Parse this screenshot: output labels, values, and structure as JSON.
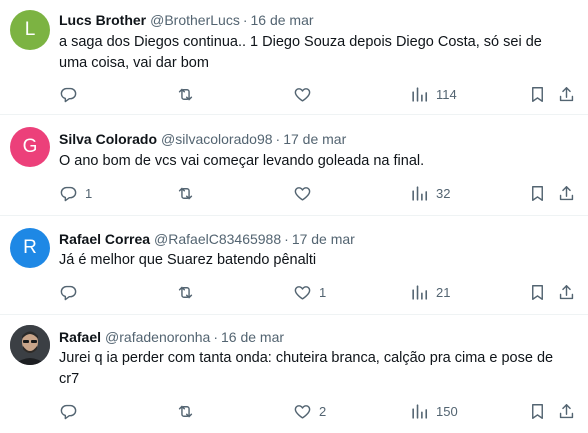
{
  "tweets": [
    {
      "avatar_letter": "L",
      "avatar_color": "#7cb342",
      "name": "Lucs Brother",
      "handle": "@BrotherLucs",
      "separator": "·",
      "date": "16 de mar",
      "text": "a saga dos Diegos continua.. 1 Diego Souza depois Diego Costa, só sei de uma coisa, vai dar bom",
      "replies": "",
      "retweets": "",
      "likes": "",
      "views": "114"
    },
    {
      "avatar_letter": "G",
      "avatar_color": "#ec407a",
      "name": "Silva Colorado",
      "handle": "@silvacolorado98",
      "separator": "·",
      "date": "17 de mar",
      "text": "O ano bom de vcs vai começar levando goleada na final.",
      "replies": "1",
      "retweets": "",
      "likes": "",
      "views": "32"
    },
    {
      "avatar_letter": "R",
      "avatar_color": "#1e88e5",
      "name": "Rafael Correa",
      "handle": "@RafaelC83465988",
      "separator": "·",
      "date": "17 de mar",
      "text": "Já é melhor que Suarez batendo pênalti",
      "replies": "",
      "retweets": "",
      "likes": "1",
      "views": "21"
    },
    {
      "avatar_letter": "",
      "avatar_color": "#4a4f55",
      "name": "Rafael",
      "handle": "@rafadenoronha",
      "separator": "·",
      "date": "16 de mar",
      "text": "Jurei q ia perder com tanta onda: chuteira branca, calção pra cima e pose de cr7",
      "replies": "",
      "retweets": "",
      "likes": "2",
      "views": "150"
    }
  ],
  "icons": {
    "reply": "reply-icon",
    "retweet": "retweet-icon",
    "like": "heart-icon",
    "views": "views-icon",
    "bookmark": "bookmark-icon",
    "share": "share-icon"
  },
  "colors": {
    "text": "#0f1419",
    "muted": "#536471",
    "divider": "#eff3f4"
  }
}
